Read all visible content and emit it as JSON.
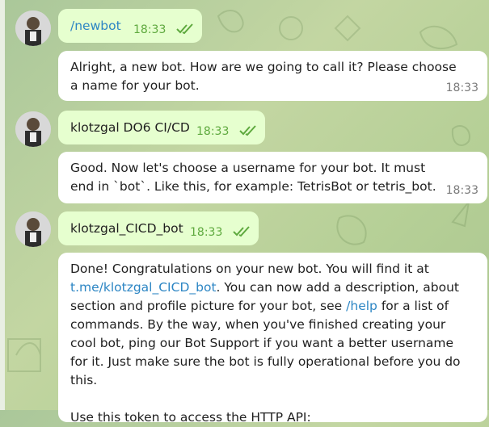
{
  "messages": [
    {
      "side": "outgoing",
      "text": "/newbot",
      "time": "18:33"
    },
    {
      "side": "incoming",
      "text": "Alright, a new bot. How are we going to call it? Please choose a name for your bot.",
      "time": "18:33"
    },
    {
      "side": "outgoing",
      "text": "klotzgal DO6 CI/CD",
      "time": "18:33"
    },
    {
      "side": "incoming",
      "text": "Good. Now let's choose a username for your bot. It must end in `bot`. Like this, for example: TetrisBot or tetris_bot.",
      "time": "18:33"
    },
    {
      "side": "outgoing",
      "text": "klotzgal_CICD_bot",
      "time": "18:33"
    },
    {
      "side": "incoming",
      "text_before_link": "Done! Congratulations on your new bot. You will find it at",
      "link": "t.me/klotzgal_CICD_bot",
      "text_after_link": ". You can now add a description, about section and profile picture for your bot, see",
      "help_command": "/help",
      "text_after_help": "for a list of commands. By the way, when you've finished creating your cool bot, ping our Bot Support if you want a better username for it. Just make sure the bot is fully operational before you do this.",
      "token_text": "Use this token to access the HTTP API:"
    }
  ],
  "colors": {
    "outgoing_bubble": "#e6ffcf",
    "incoming_bubble": "#ffffff",
    "link": "#2d86c4",
    "outgoing_time": "#5ea93e"
  },
  "icons": [
    "avatar",
    "double-check-icon"
  ]
}
